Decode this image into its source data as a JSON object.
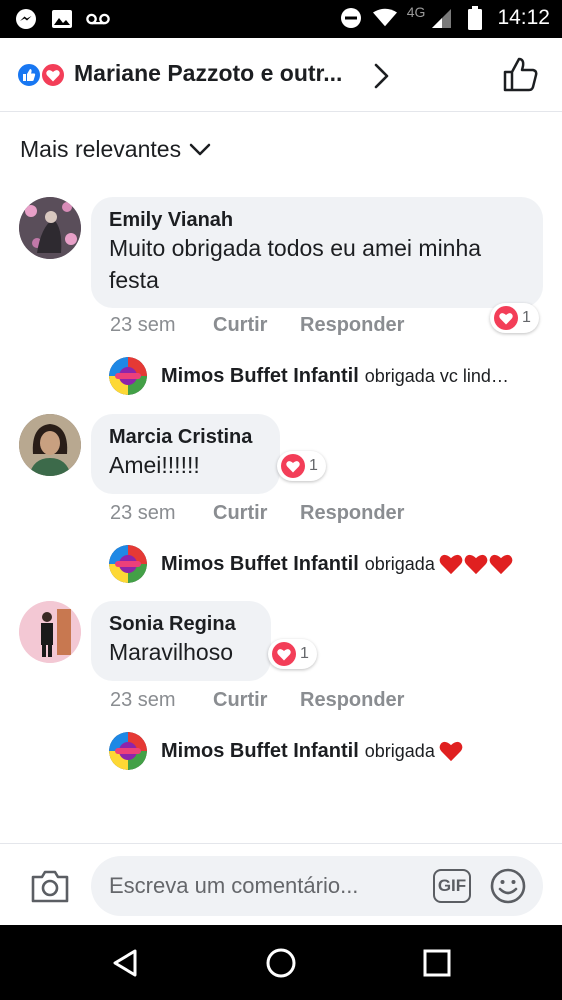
{
  "status_bar": {
    "time": "14:12",
    "network": "4G",
    "icons": [
      "messenger-icon",
      "image-icon",
      "voicemail-icon",
      "do-not-disturb-icon",
      "wifi-icon",
      "signal-icon",
      "battery-icon"
    ]
  },
  "header": {
    "title": "Mariane Pazzoto e outr...",
    "reactions": [
      "like-reaction-icon",
      "love-reaction-icon"
    ],
    "like_accent": "#1877f2",
    "love_accent": "#f33e58"
  },
  "sort": {
    "label": "Mais relevantes"
  },
  "comments": [
    {
      "author": "Emily Vianah",
      "text": "Muito obrigada  todos eu amei minha festa",
      "time": "23 sem",
      "like_label": "Curtir",
      "reply_label": "Responder",
      "reaction_count": "1",
      "reply": {
        "author": "Mimos Buffet Infantil",
        "text": "obrigada vc lind…",
        "hearts": 0
      }
    },
    {
      "author": "Marcia Cristina",
      "text": "Amei!!!!!!",
      "time": "23 sem",
      "like_label": "Curtir",
      "reply_label": "Responder",
      "reaction_count": "1",
      "reply": {
        "author": "Mimos Buffet Infantil",
        "text": "obrigada",
        "hearts": 3
      }
    },
    {
      "author": "Sonia Regina",
      "text": "Maravilhoso",
      "time": "23 sem",
      "like_label": "Curtir",
      "reply_label": "Responder",
      "reaction_count": "1",
      "reply": {
        "author": "Mimos Buffet Infantil",
        "text": "obrigada",
        "hearts": 1
      }
    }
  ],
  "composer": {
    "placeholder": "Escreva um comentário...",
    "gif_label": "GIF"
  }
}
